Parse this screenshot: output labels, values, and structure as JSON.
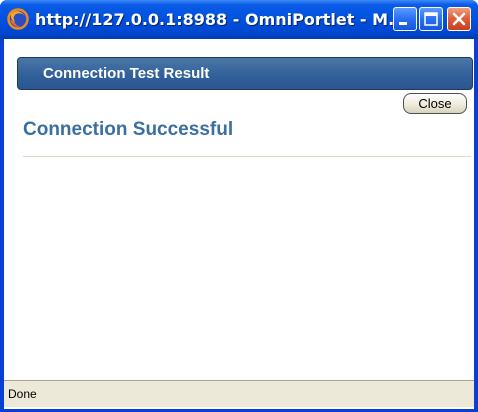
{
  "window": {
    "title": "http://127.0.0.1:8988 - OmniPortlet - M...",
    "icon": "firefox-icon",
    "titlebar_color": "#0054e3"
  },
  "titlebar_buttons": {
    "minimize": "minimize-icon",
    "maximize": "maximize-icon",
    "close": "close-icon"
  },
  "page": {
    "header_title": "Connection Test Result",
    "close_label": "Close",
    "result_heading": "Connection Successful",
    "accent_color": "#3b6fa0"
  },
  "statusbar": {
    "text": "Done"
  }
}
